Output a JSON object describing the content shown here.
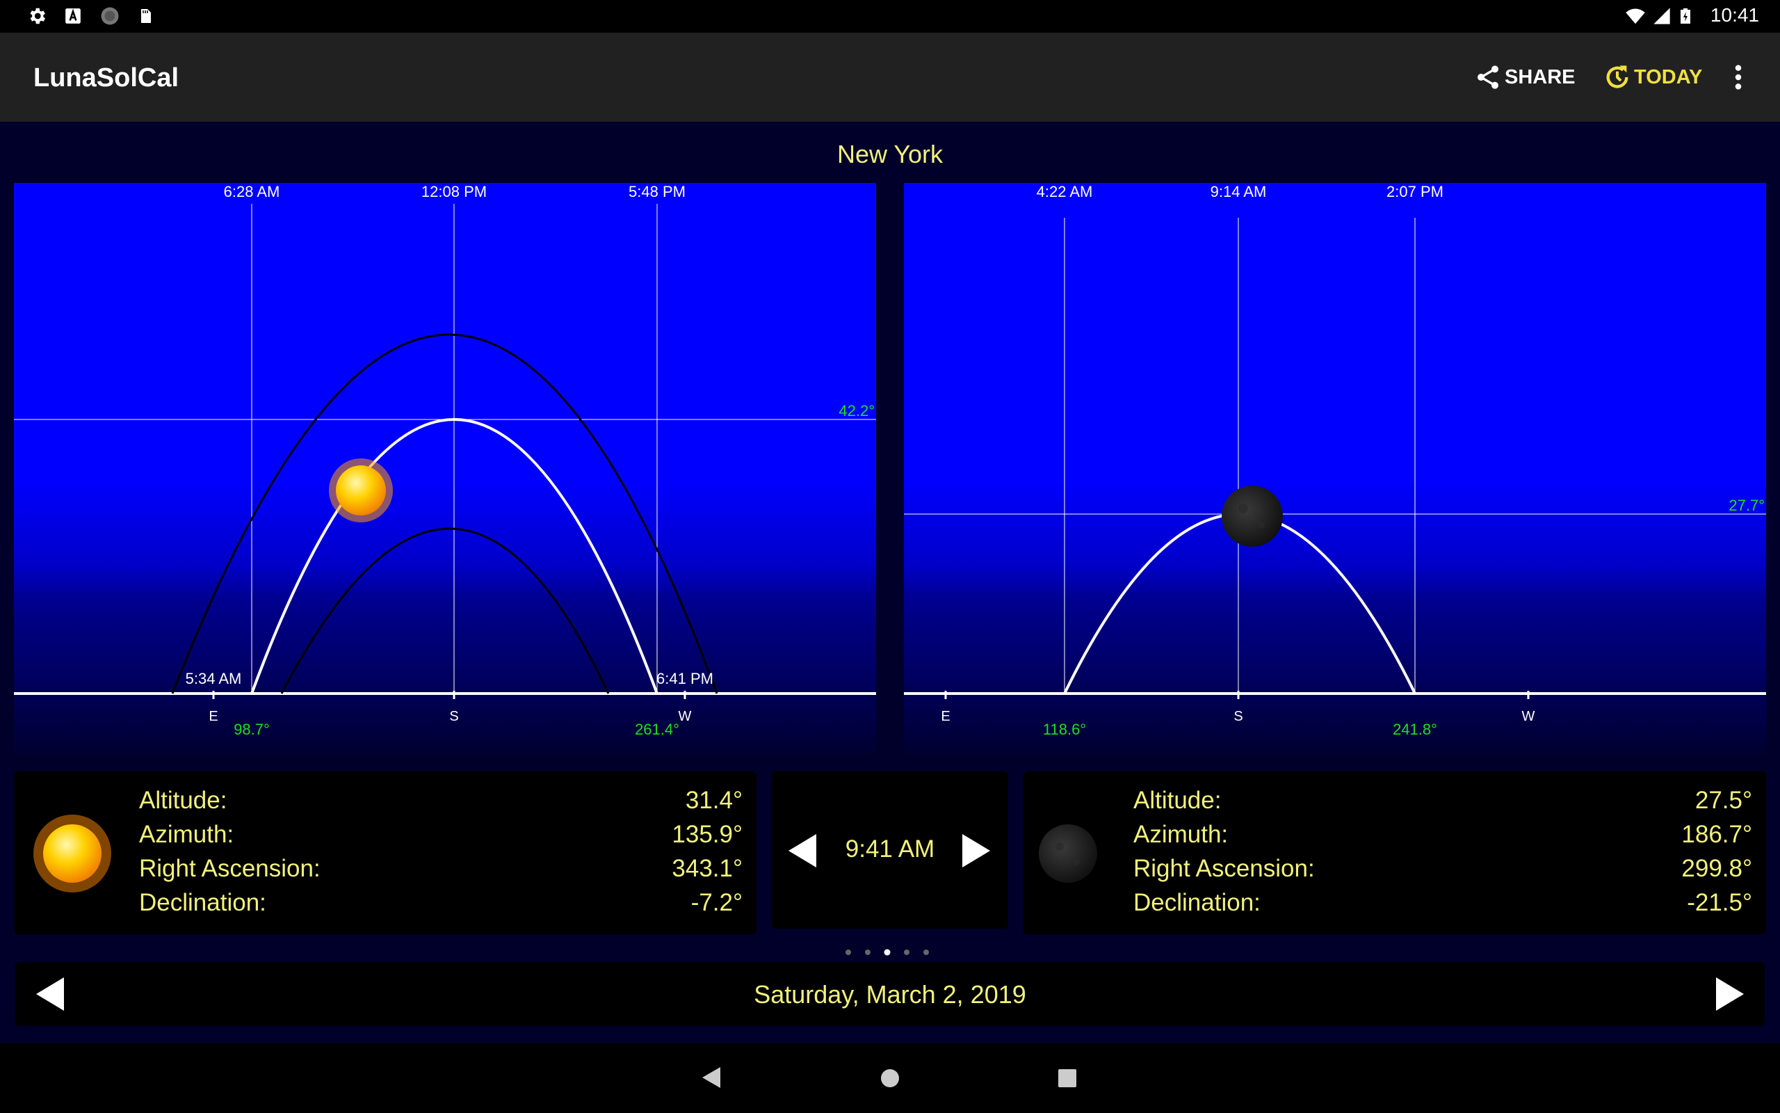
{
  "status_bar": {
    "time": "10:41"
  },
  "toolbar": {
    "title": "LunaSolCal",
    "share_label": "SHARE",
    "today_label": "TODAY",
    "accent": "#f0e040"
  },
  "location": "New York",
  "sun_chart": {
    "times": [
      "6:28 AM",
      "12:08 PM",
      "5:48 PM"
    ],
    "rise_time": "5:34 AM",
    "set_time": "6:41 PM",
    "max_altitude": "42.2°",
    "rise_azimuth": "98.7°",
    "set_azimuth": "261.4°",
    "compass": [
      "E",
      "S",
      "W"
    ]
  },
  "moon_chart": {
    "times": [
      "4:22 AM",
      "9:14 AM",
      "2:07 PM"
    ],
    "max_altitude": "27.7°",
    "rise_azimuth": "118.6°",
    "set_azimuth": "241.8°",
    "compass": [
      "E",
      "S",
      "W"
    ]
  },
  "sun_info": {
    "altitude_label": "Altitude:",
    "altitude": "31.4°",
    "azimuth_label": "Azimuth:",
    "azimuth": "135.9°",
    "ra_label": "Right Ascension:",
    "ra": "343.1°",
    "dec_label": "Declination:",
    "dec": "-7.2°"
  },
  "moon_info": {
    "altitude_label": "Altitude:",
    "altitude": "27.5°",
    "azimuth_label": "Azimuth:",
    "azimuth": "186.7°",
    "ra_label": "Right Ascension:",
    "ra": "299.8°",
    "dec_label": "Declination:",
    "dec": "-21.5°"
  },
  "time_control": {
    "time": "9:41 AM"
  },
  "date_control": {
    "date": "Saturday, March 2, 2019"
  },
  "colors": {
    "text_yellow": "#f2f27a",
    "green_label": "#22dd22",
    "sky_blue": "#0000ff",
    "background": "#00002a"
  }
}
